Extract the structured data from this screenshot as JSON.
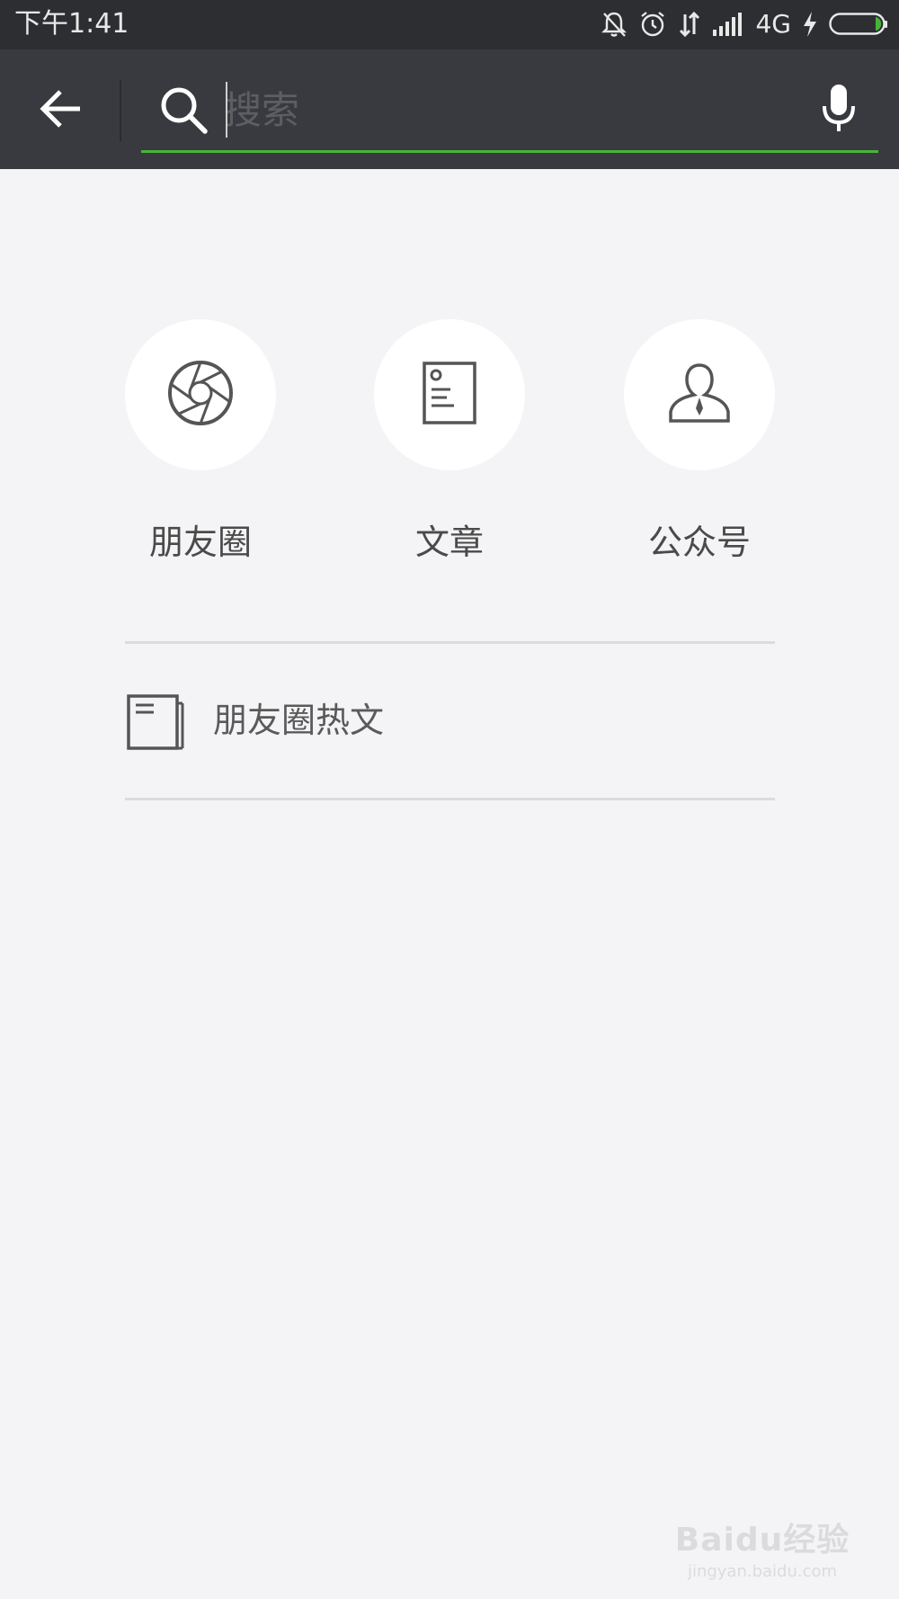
{
  "status_bar": {
    "time": "下午1:41",
    "network": "4G",
    "icons": [
      "bell-off-icon",
      "alarm-icon",
      "data-transfer-icon",
      "signal-icon",
      "charging-icon",
      "battery-icon"
    ],
    "accent_color": "#46b537"
  },
  "search_bar": {
    "placeholder": "搜索",
    "value": "",
    "back_icon": "arrow-left-icon",
    "search_icon": "search-icon",
    "voice_icon": "microphone-icon",
    "underline_color": "#46b537"
  },
  "categories": [
    {
      "label": "朋友圈",
      "icon": "aperture-icon"
    },
    {
      "label": "文章",
      "icon": "document-icon"
    },
    {
      "label": "公众号",
      "icon": "person-icon"
    }
  ],
  "hot_articles": {
    "label": "朋友圈热文",
    "icon": "newspaper-icon"
  },
  "watermark": {
    "brand": "Baidu经验",
    "url": "jingyan.baidu.com"
  }
}
